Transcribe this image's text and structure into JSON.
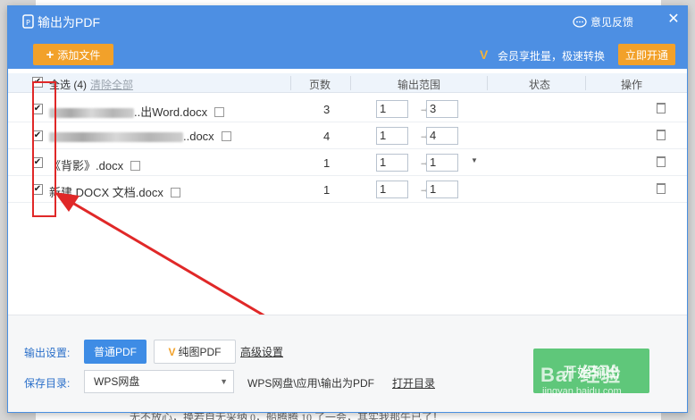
{
  "background_doc": {
    "text": "无不放心，换若自无采纳 0，船腾腾 10 了一会，其实我那午已了！"
  },
  "dialog": {
    "title": "输出为PDF",
    "feedback_label": "意见反馈",
    "close_glyph": "✕"
  },
  "toolbar": {
    "add_file_label": "添加文件",
    "add_icon": "+",
    "vip_badge": "V",
    "vip_text": "会员享批量，极速转换",
    "open_vip_label": "立即开通"
  },
  "table": {
    "select_all_label": "全选 (4)",
    "clear_all_label": "清除全部",
    "columns": {
      "pages": "页数",
      "range": "输出范围",
      "status": "状态",
      "action": "操作"
    },
    "range_arrow": "→",
    "rows": [
      {
        "name": "..出Word.docx",
        "has_blur_prefix": true,
        "pages": "3",
        "from": "1",
        "to": "3",
        "checked": "✔"
      },
      {
        "name": "..docx",
        "has_blur_prefix": true,
        "pages": "4",
        "from": "1",
        "to": "4",
        "checked": "✔"
      },
      {
        "name": "《背影》.docx",
        "has_blur_prefix": false,
        "pages": "1",
        "from": "1",
        "to": "1",
        "checked": "✔"
      },
      {
        "name": "新建 DOCX 文档.docx",
        "has_blur_prefix": false,
        "pages": "1",
        "from": "1",
        "to": "1",
        "checked": "✔"
      }
    ]
  },
  "settings": {
    "output_label": "输出设置:",
    "normal_pdf_label": "普通PDF",
    "image_pdf_label": "纯图PDF",
    "advanced_label": "高级设置",
    "save_dir_label": "保存目录:",
    "save_location": "WPS网盘",
    "save_path": "WPS网盘\\应用\\输出为PDF",
    "open_dir_label": "打开目录",
    "start_label": "开始输出"
  },
  "watermark": {
    "text": "Bai  经验",
    "sub": "jingyan.baidu.com"
  },
  "colors": {
    "titlebar": "#4d8fe3",
    "accent_orange": "#f2a12a",
    "primary_blue": "#3e8ce5",
    "start_green": "#5fc77a",
    "annotation_red": "#e02828"
  }
}
